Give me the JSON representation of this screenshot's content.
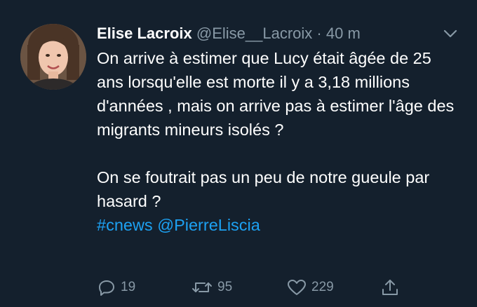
{
  "user": {
    "name": "Elise Lacroix",
    "handle": "@Elise__Lacroix",
    "separator": "·",
    "time": "40 m"
  },
  "tweet": {
    "para1": "On arrive à estimer que Lucy était âgée de 25 ans lorsqu'elle est morte il y a 3,18 millions d'années , mais on arrive pas à estimer l'âge des migrants mineurs isolés ?",
    "para2": "On se foutrait pas un peu de notre gueule par hasard ?",
    "hashtag": "#cnews",
    "mention": "@PierreLiscia"
  },
  "actions": {
    "replies": "19",
    "retweets": "95",
    "likes": "229"
  },
  "colors": {
    "background": "#14202d",
    "link": "#1da1f2",
    "muted": "#8899a6"
  },
  "icons": [
    "reply-icon",
    "retweet-icon",
    "like-icon",
    "share-icon",
    "chevron-down-icon"
  ]
}
